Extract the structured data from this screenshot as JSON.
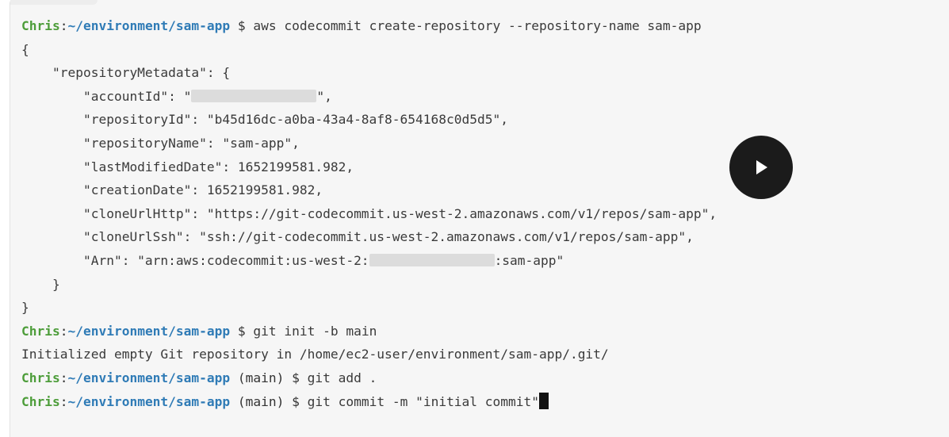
{
  "prompt": {
    "user": "Chris",
    "path": "~/environment/sam-app",
    "branch": "(main)"
  },
  "lines": {
    "cmd1": "aws codecommit create-repository --repository-name sam-app",
    "brace_open": "{",
    "meta_open": "    \"repositoryMetadata\": {",
    "account_pre": "        \"accountId\": \"",
    "account_post": "\",",
    "repo_id": "        \"repositoryId\": \"b45d16dc-a0ba-43a4-8af8-654168c0d5d5\",",
    "repo_name": "        \"repositoryName\": \"sam-app\",",
    "last_modified": "        \"lastModifiedDate\": 1652199581.982,",
    "creation": "        \"creationDate\": 1652199581.982,",
    "clone_http": "        \"cloneUrlHttp\": \"https://git-codecommit.us-west-2.amazonaws.com/v1/repos/sam-app\",",
    "clone_ssh": "        \"cloneUrlSsh\": \"ssh://git-codecommit.us-west-2.amazonaws.com/v1/repos/sam-app\",",
    "arn_pre": "        \"Arn\": \"arn:aws:codecommit:us-west-2:",
    "arn_post": ":sam-app\"",
    "meta_close": "    }",
    "brace_close": "}",
    "cmd2": "git init -b main",
    "init_output": "Initialized empty Git repository in /home/ec2-user/environment/sam-app/.git/",
    "cmd3": "git add .",
    "cmd4": "git commit -m \"initial commit\""
  },
  "video": {
    "play_icon": "play-icon"
  }
}
